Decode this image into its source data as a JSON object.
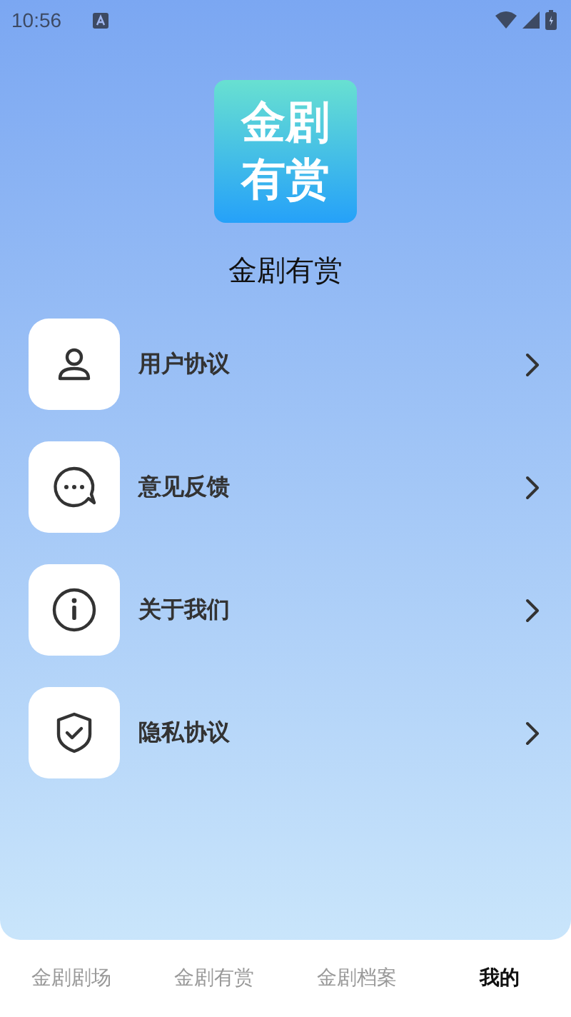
{
  "status_bar": {
    "time": "10:56"
  },
  "logo": {
    "lines": [
      "金剧",
      "有赏"
    ]
  },
  "app_name": "金剧有赏",
  "menu": [
    {
      "kind": "person",
      "label": "用户协议"
    },
    {
      "kind": "chat",
      "label": "意见反馈"
    },
    {
      "kind": "info",
      "label": "关于我们"
    },
    {
      "kind": "shield",
      "label": "隐私协议"
    }
  ],
  "tabs": [
    {
      "label": "金剧剧场",
      "selected": false
    },
    {
      "label": "金剧有赏",
      "selected": false
    },
    {
      "label": "金剧档案",
      "selected": false
    },
    {
      "label": "我的",
      "selected": true
    }
  ]
}
